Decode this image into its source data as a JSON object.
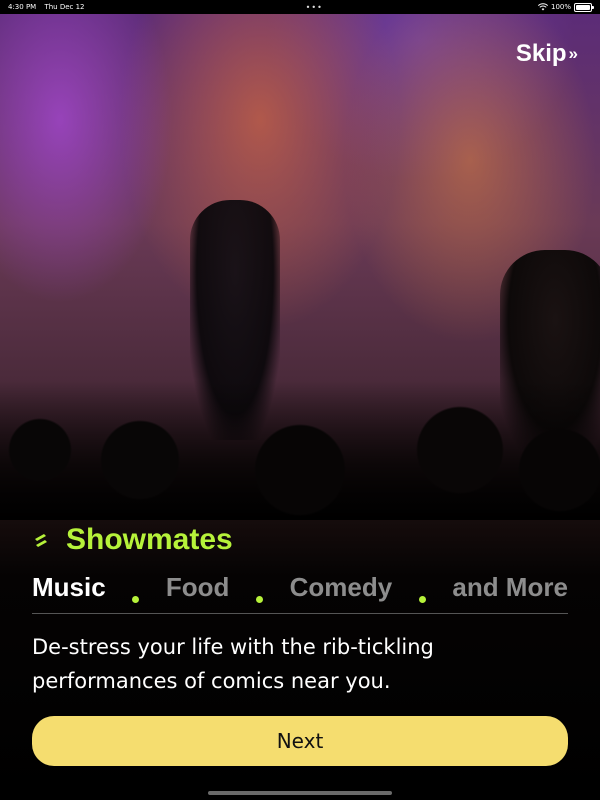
{
  "status_bar": {
    "time": "4:30 PM",
    "date": "Thu Dec 12",
    "dots": "•••",
    "battery": "100%",
    "wifi_icon": "wifi-icon",
    "battery_icon": "battery-icon"
  },
  "skip": {
    "label": "Skip",
    "icon": "double-chevron-right-icon",
    "chevron": "»"
  },
  "brand": {
    "name": "Showmates",
    "logo_icon": "showmates-logo-icon",
    "color": "#b6f23a"
  },
  "categories": [
    {
      "label": "Music",
      "active": true
    },
    {
      "label": "Food",
      "active": false
    },
    {
      "label": "Comedy",
      "active": false
    },
    {
      "label": "and More",
      "active": false
    }
  ],
  "description": "De-stress your life with the rib-tickling performances of comics near you.",
  "next_button": {
    "label": "Next",
    "color": "#f5dd6f"
  }
}
